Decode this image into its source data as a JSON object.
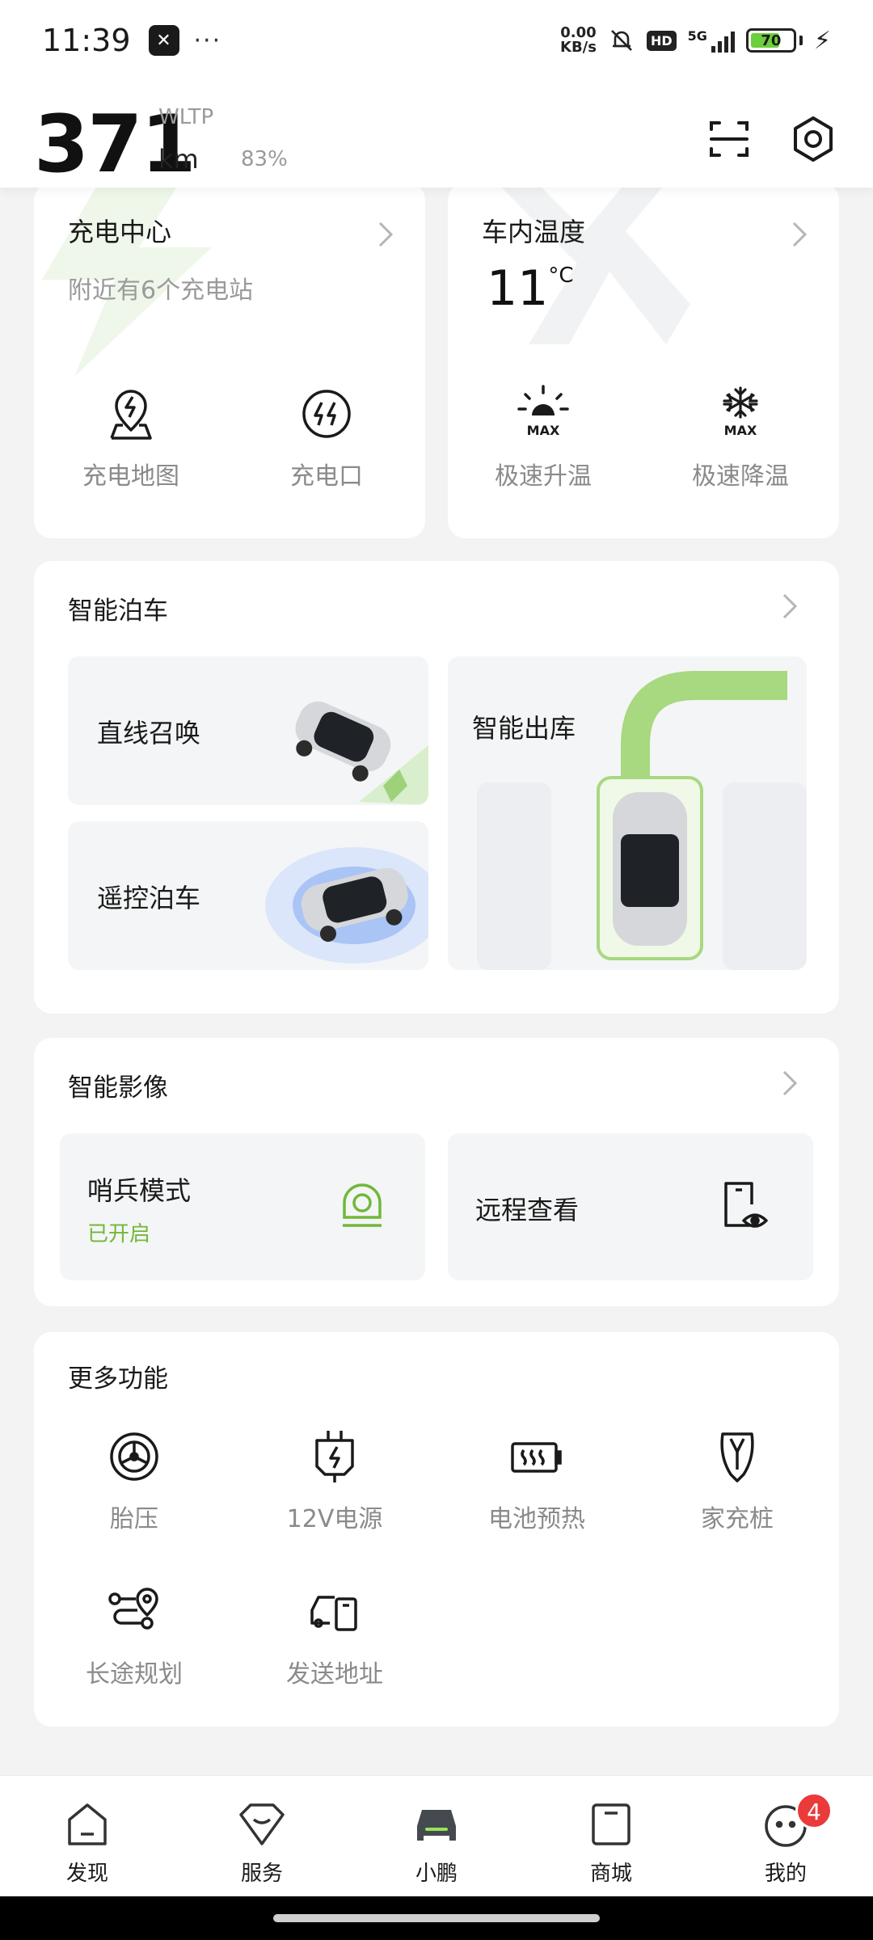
{
  "status_bar": {
    "time": "11:39",
    "dots": "···",
    "speed_value": "0.00",
    "speed_unit": "KB/s",
    "hd": "HD",
    "network": "5G",
    "battery_level": "70",
    "battery_fraction": 0.7
  },
  "header": {
    "range_value": "371",
    "range_standard": "WLTP",
    "range_unit": "km",
    "battery_percent": "83%"
  },
  "charging_card": {
    "title": "充电中心",
    "subtitle": "附近有6个充电站",
    "actions": [
      {
        "label": "充电地图",
        "icon": "map-pin-bolt-icon"
      },
      {
        "label": "充电口",
        "icon": "charge-port-icon"
      }
    ]
  },
  "climate_card": {
    "title": "车内温度",
    "temp_value": "11",
    "temp_unit": "°C",
    "actions": [
      {
        "label": "极速升温",
        "icon": "sun-max-icon",
        "badge": "MAX"
      },
      {
        "label": "极速降温",
        "icon": "snowflake-max-icon",
        "badge": "MAX"
      }
    ]
  },
  "parking_card": {
    "title": "智能泊车",
    "tiles": [
      {
        "label": "直线召唤"
      },
      {
        "label": "遥控泊车"
      },
      {
        "label": "智能出库"
      }
    ]
  },
  "camera_card": {
    "title": "智能影像",
    "sentry": {
      "label": "哨兵模式",
      "status": "已开启"
    },
    "remote": {
      "label": "远程查看"
    }
  },
  "more_card": {
    "title": "更多功能",
    "items": [
      {
        "label": "胎压",
        "icon": "tire-icon"
      },
      {
        "label": "12V电源",
        "icon": "plug-bolt-icon"
      },
      {
        "label": "电池预热",
        "icon": "battery-heat-icon"
      },
      {
        "label": "家充桩",
        "icon": "home-charger-icon"
      },
      {
        "label": "长途规划",
        "icon": "route-icon"
      },
      {
        "label": "发送地址",
        "icon": "send-to-car-icon"
      }
    ]
  },
  "bottom_nav": {
    "items": [
      {
        "label": "发现",
        "icon": "discover-icon"
      },
      {
        "label": "服务",
        "icon": "service-icon"
      },
      {
        "label": "小鹏",
        "icon": "car-icon"
      },
      {
        "label": "商城",
        "icon": "shop-icon"
      },
      {
        "label": "我的",
        "icon": "profile-icon"
      }
    ],
    "profile_badge": "4"
  },
  "colors": {
    "accent_green": "#71b83a",
    "badge_red": "#ea3a3a",
    "battery_green": "#6ccf3b"
  }
}
